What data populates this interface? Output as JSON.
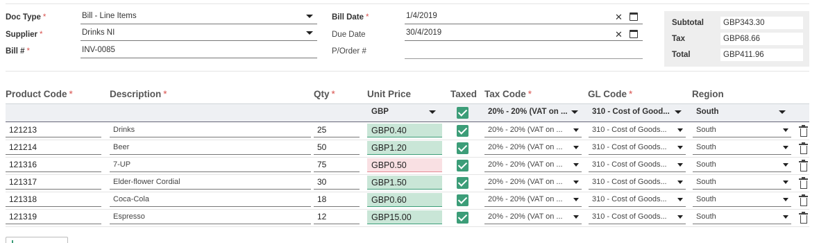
{
  "header": {
    "doc_type": {
      "label": "Doc Type",
      "required": "*",
      "value": "Bill - Line Items"
    },
    "supplier": {
      "label": "Supplier",
      "required": "*",
      "value": "Drinks NI"
    },
    "bill_no": {
      "label": "Bill #",
      "required": "*",
      "value": "INV-0085"
    },
    "bill_date": {
      "label": "Bill Date",
      "required": "*",
      "value": "1/4/2019"
    },
    "due_date": {
      "label": "Due Date",
      "value": "30/4/2019"
    },
    "po": {
      "label": "P/Order #",
      "value": ""
    }
  },
  "totals": {
    "subtotal_label": "Subtotal",
    "subtotal": "GBP343.30",
    "tax_label": "Tax",
    "tax": "GBP68.66",
    "total_label": "Total",
    "total": "GBP411.96"
  },
  "columns": {
    "product_code": "Product Code",
    "description": "Description",
    "qty": "Qty",
    "unit_price": "Unit Price",
    "taxed": "Taxed",
    "tax_code": "Tax Code",
    "gl_code": "GL Code",
    "region": "Region",
    "required": "*"
  },
  "defaults": {
    "currency": "GBP",
    "tax_code": "20% - 20% (VAT on ...",
    "gl_code": "310 - Cost of Good...",
    "region": "South"
  },
  "rows": [
    {
      "code": "121213",
      "desc": "Drinks",
      "qty": "25",
      "price": "GBP0.40",
      "price_state": "ok",
      "tax_code": "20% - 20% (VAT on ...",
      "gl": "310 - Cost of Goods...",
      "region": "South"
    },
    {
      "code": "121214",
      "desc": "Beer",
      "qty": "50",
      "price": "GBP1.20",
      "price_state": "ok",
      "tax_code": "20% - 20% (VAT on ...",
      "gl": "310 - Cost of Goods...",
      "region": "South"
    },
    {
      "code": "121316",
      "desc": "7-UP",
      "qty": "75",
      "price": "GBP0.50",
      "price_state": "warn",
      "tax_code": "20% - 20% (VAT on ...",
      "gl": "310 - Cost of Goods...",
      "region": "South"
    },
    {
      "code": "121317",
      "desc": "Elder-flower Cordial",
      "qty": "30",
      "price": "GBP1.50",
      "price_state": "ok",
      "tax_code": "20% - 20% (VAT on ...",
      "gl": "310 - Cost of Goods...",
      "region": "South"
    },
    {
      "code": "121318",
      "desc": "Coca-Cola",
      "qty": "18",
      "price": "GBP0.60",
      "price_state": "ok",
      "tax_code": "20% - 20% (VAT on ...",
      "gl": "310 - Cost of Goods...",
      "region": "South"
    },
    {
      "code": "121319",
      "desc": "Espresso",
      "qty": "12",
      "price": "GBP15.00",
      "price_state": "ok",
      "tax_code": "20% - 20% (VAT on ...",
      "gl": "310 - Cost of Goods...",
      "region": "South"
    }
  ],
  "colors": {
    "accent": "#3c9d78",
    "required": "#d9534f",
    "price_ok_bg": "#c9e6d7",
    "price_warn_bg": "#f9e0e3"
  },
  "icons": {
    "clear": "close-icon",
    "calendar": "calendar-icon",
    "delete": "trash-icon",
    "taxed": "checkbox-checked"
  }
}
